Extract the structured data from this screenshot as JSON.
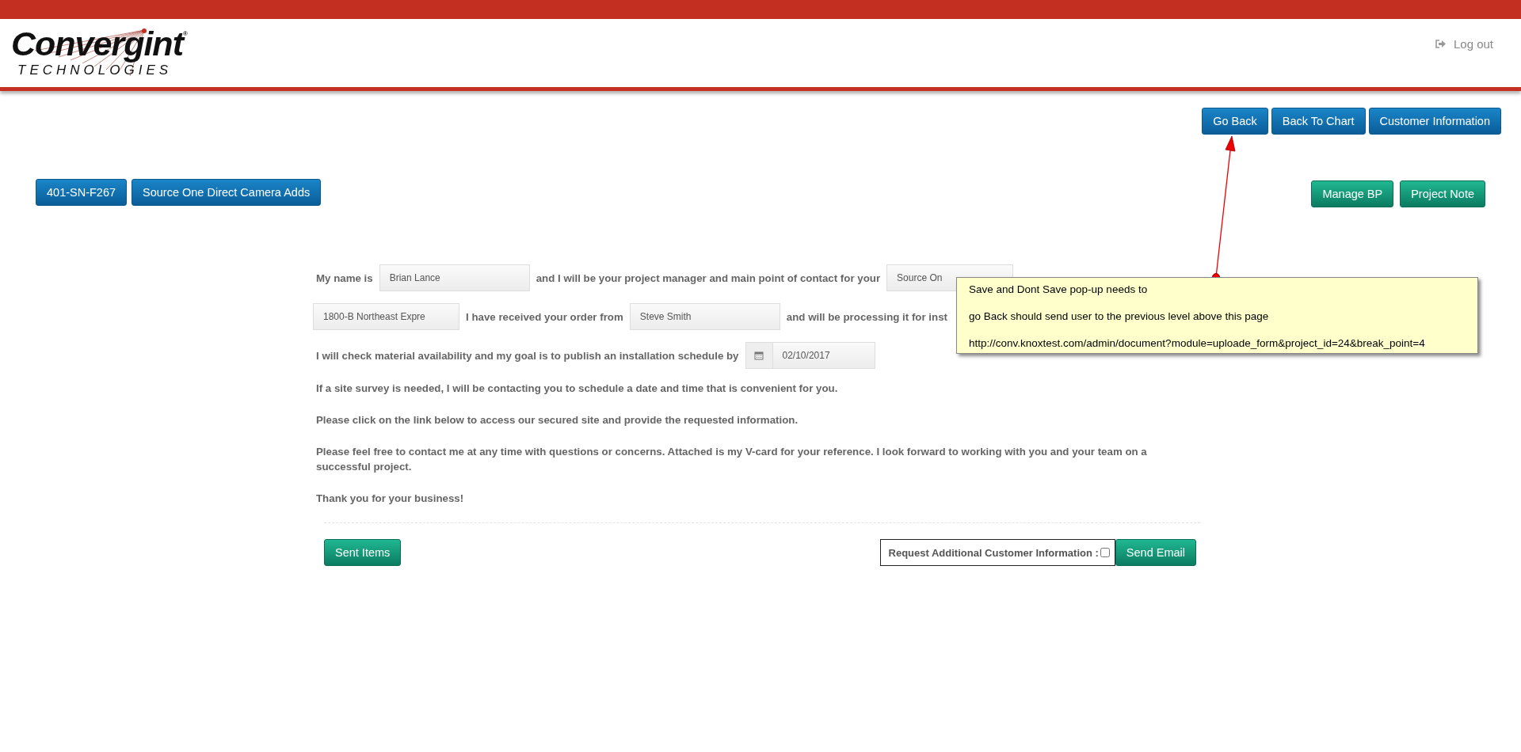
{
  "header": {
    "logo": {
      "name": "Convergint",
      "mark": "®",
      "tagline": "TECHNOLOGIES"
    },
    "logout": "Log out"
  },
  "nav_buttons": [
    "Go Back",
    "Back To Chart",
    "Customer Information"
  ],
  "project_buttons": [
    "401-SN-F267",
    "Source One Direct Camera Adds"
  ],
  "action_buttons": [
    "Manage BP",
    "Project Note"
  ],
  "letter": {
    "rows": [
      {
        "parts": [
          {
            "kind": "text",
            "text": "My name is"
          },
          {
            "kind": "field",
            "value": "Brian Lance"
          },
          {
            "kind": "text",
            "text": "and I will be your project manager and main point of contact for your"
          },
          {
            "kind": "field",
            "value": "Source On"
          }
        ]
      },
      {
        "parts": [
          {
            "kind": "field",
            "value": "1800-B Northeast Expre"
          },
          {
            "kind": "text",
            "text": "I have received your order from"
          },
          {
            "kind": "field",
            "value": "Steve Smith"
          },
          {
            "kind": "text",
            "text": "and will be processing it for inst"
          }
        ]
      },
      {
        "parts": [
          {
            "kind": "text",
            "text": "I will check material availability and my goal is to publish an installation schedule by"
          },
          {
            "kind": "date",
            "value": "02/10/2017"
          }
        ]
      }
    ],
    "paragraphs": [
      "If a site survey is needed, I will be contacting you to schedule a date and time that is convenient for you.",
      "Please click on the link below to access our secured site and provide the requested information.",
      "Please feel free to contact me at any time with questions or concerns. Attached is my V-card for your reference. I look forward to working with you and your team on a successful project.",
      "Thank you for your business!"
    ]
  },
  "footer": {
    "sent_button": "Sent Items",
    "request": {
      "label": "Request Additional Customer Information :",
      "checked": false
    },
    "send_button": "Send Email"
  },
  "note": {
    "lines": [
      "Save and Dont Save pop-up needs to",
      "go Back should send user to the previous level above this page",
      "http://conv.knoxtest.com/admin/document?module=uploade_form&project_id=24&break_point=4"
    ]
  }
}
